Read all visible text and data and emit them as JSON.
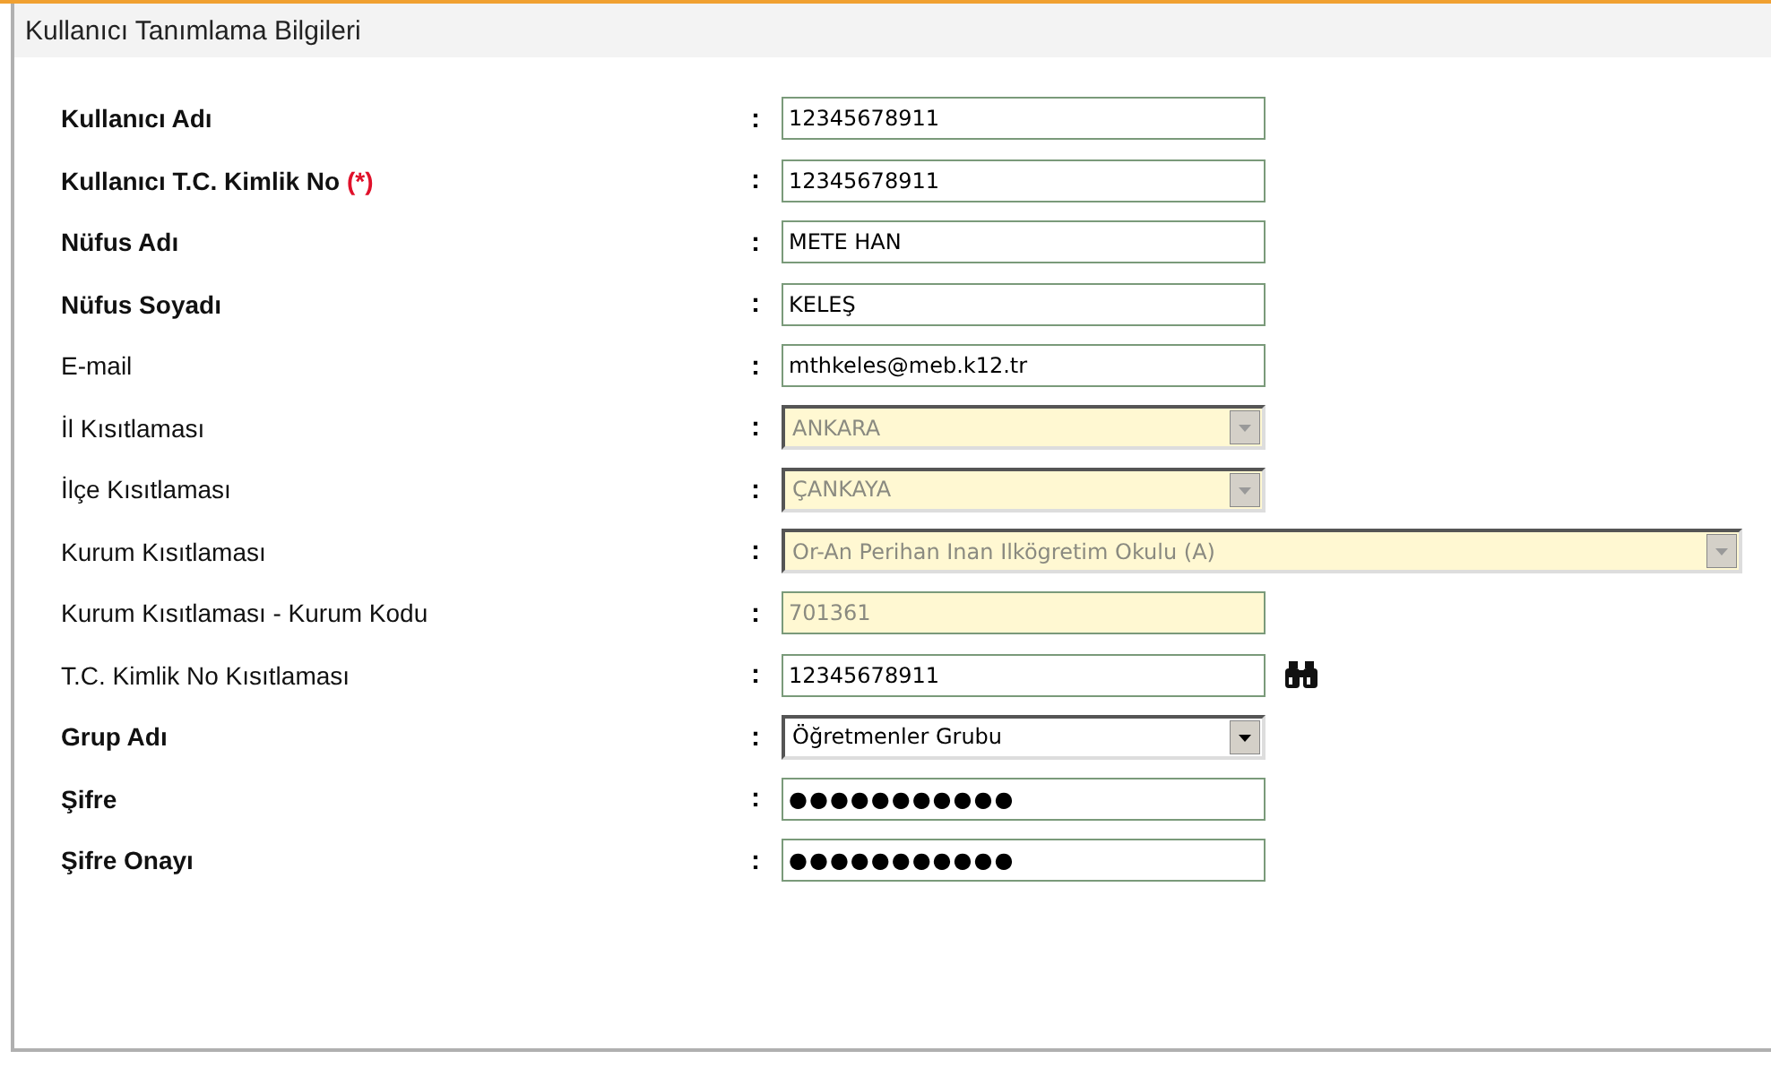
{
  "panel": {
    "title": "Kullanıcı Tanımlama Bilgileri"
  },
  "fields": [
    {
      "label": "Kullanıcı Adı",
      "bold": true,
      "separator": ":",
      "kind": "text",
      "value": "12345678911",
      "disabled": false
    },
    {
      "label": "Kullanıcı T.C. Kimlik No",
      "required_mark": "(*)",
      "bold": true,
      "separator": ":",
      "kind": "text",
      "value": "12345678911",
      "disabled": false
    },
    {
      "label": "Nüfus Adı",
      "bold": true,
      "separator": ":",
      "kind": "text",
      "value": "METE HAN",
      "disabled": false
    },
    {
      "label": "Nüfus Soyadı",
      "bold": true,
      "separator": ":",
      "kind": "text",
      "value": "KELEŞ",
      "disabled": false
    },
    {
      "label": "E-mail",
      "bold": false,
      "separator": ":",
      "kind": "text",
      "value": "mthkeles@meb.k12.tr",
      "disabled": false
    },
    {
      "label": "İl Kısıtlaması",
      "bold": false,
      "separator": ":",
      "kind": "select",
      "value": "ANKARA",
      "disabled": true
    },
    {
      "label": "İlçe Kısıtlaması",
      "bold": false,
      "separator": ":",
      "kind": "select",
      "value": "ÇANKAYA",
      "disabled": true
    },
    {
      "label": "Kurum Kısıtlaması",
      "bold": false,
      "separator": ":",
      "kind": "select",
      "wide": true,
      "value": "Or-An Perihan Inan Ilkögretim Okulu (A)",
      "disabled": true
    },
    {
      "label": "Kurum Kısıtlaması - Kurum Kodu",
      "bold": false,
      "separator": ":",
      "kind": "text",
      "value": "701361",
      "disabled": true
    },
    {
      "label": "T.C. Kimlik No Kısıtlaması",
      "bold": false,
      "separator": ":",
      "kind": "text",
      "value": "12345678911",
      "disabled": false,
      "search": true
    },
    {
      "label": "Grup Adı",
      "bold": true,
      "separator": ":",
      "kind": "select",
      "value": "Öğretmenler Grubu",
      "disabled": false
    },
    {
      "label": "Şifre",
      "bold": true,
      "separator": ":",
      "kind": "password",
      "value": "●●●●●●●●●●●",
      "disabled": false
    },
    {
      "label": "Şifre Onayı",
      "bold": true,
      "separator": ":",
      "kind": "password",
      "value": "●●●●●●●●●●●",
      "disabled": false
    }
  ]
}
